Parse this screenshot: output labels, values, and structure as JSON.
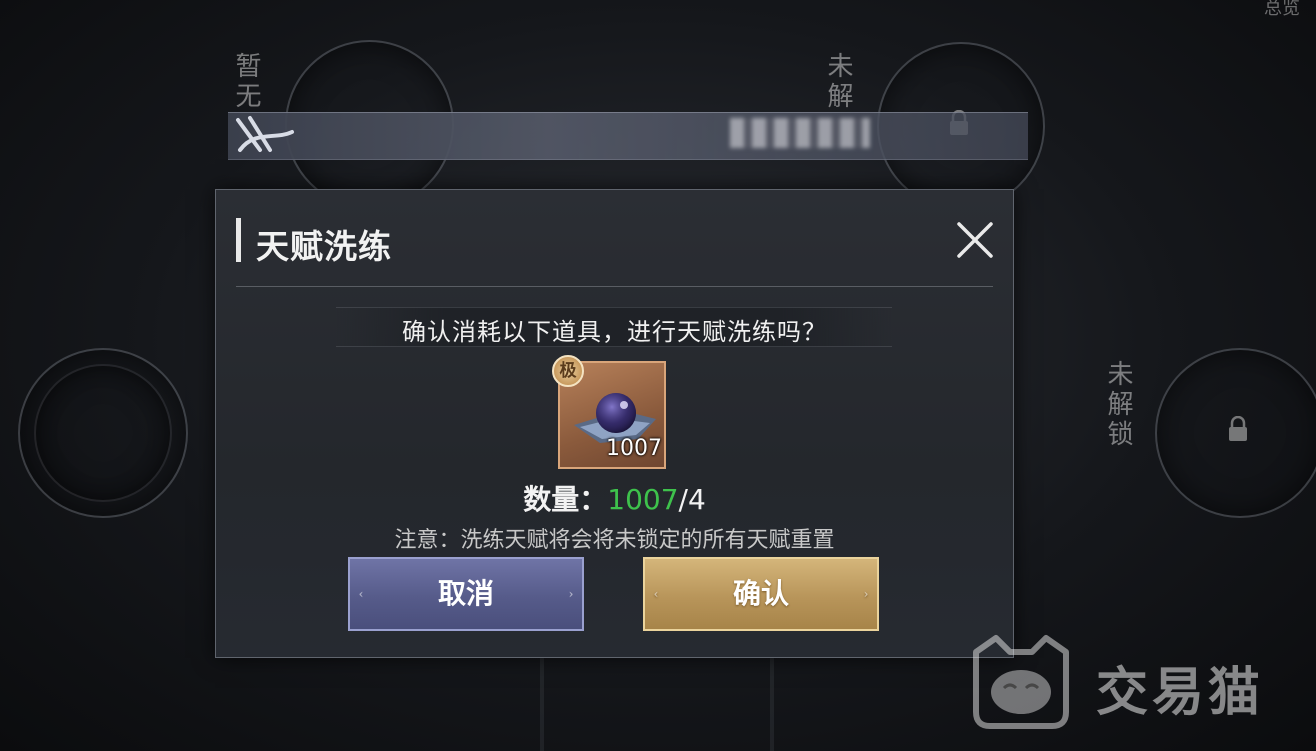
{
  "background": {
    "top_left_vertical_label": "暂无",
    "top_right_vertical_label": "未解",
    "right_vertical_label": "未解锁",
    "top_right_corner_text": "总览"
  },
  "dialog": {
    "title": "天赋洗练",
    "question": "确认消耗以下道具，进行天赋洗练吗？",
    "item": {
      "grade_badge": "极",
      "count": "1007",
      "icon": "crystal-orb-icon"
    },
    "quantity": {
      "label": "数量：",
      "have": "1007",
      "need": "/4"
    },
    "note": "注意：洗练天赋将会将未锁定的所有天赋重置",
    "buttons": {
      "cancel": "取消",
      "confirm": "确认"
    }
  },
  "watermark": {
    "text": "交易猫",
    "icon": "cat-logo-icon"
  },
  "colors": {
    "have_quantity": "#3ec24c",
    "cancel_button": "#5d6290",
    "confirm_button": "#b8955a"
  }
}
